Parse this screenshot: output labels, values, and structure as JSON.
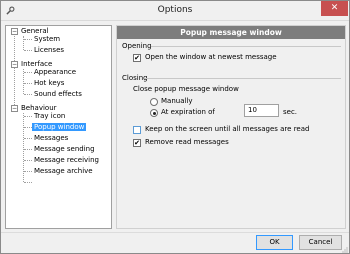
{
  "window": {
    "title": "Options",
    "close_glyph": "✕"
  },
  "tree": {
    "nodes": [
      {
        "label": "General",
        "expander": "−"
      },
      {
        "label": "System"
      },
      {
        "label": "Licenses"
      },
      {
        "label": "Interface",
        "expander": "−"
      },
      {
        "label": "Appearance"
      },
      {
        "label": "Hot keys"
      },
      {
        "label": "Sound effects"
      },
      {
        "label": "Behaviour",
        "expander": "−"
      },
      {
        "label": "Tray icon"
      },
      {
        "label": "Popup window"
      },
      {
        "label": "Messages"
      },
      {
        "label": "Message sending"
      },
      {
        "label": "Message receiving"
      },
      {
        "label": "Message archive"
      }
    ],
    "selected": "Popup window"
  },
  "panel": {
    "header": "Popup message window",
    "opening": {
      "label": "Opening",
      "open_newest": {
        "label": "Open the window at newest message",
        "checked": true
      }
    },
    "closing": {
      "label": "Closing",
      "description": "Close popup message window",
      "manually": {
        "label": "Manually",
        "selected": false
      },
      "at_expiration": {
        "label": "At expiration of",
        "selected": true
      },
      "expiration_value": "10",
      "expiration_unit": "sec.",
      "keep_on_screen": {
        "label": "Keep on the screen until all messages are read",
        "checked": false
      },
      "remove_read": {
        "label": "Remove read messages",
        "checked": true
      }
    },
    "check_glyph": "✔"
  },
  "buttons": {
    "ok": "OK",
    "cancel": "Cancel"
  }
}
